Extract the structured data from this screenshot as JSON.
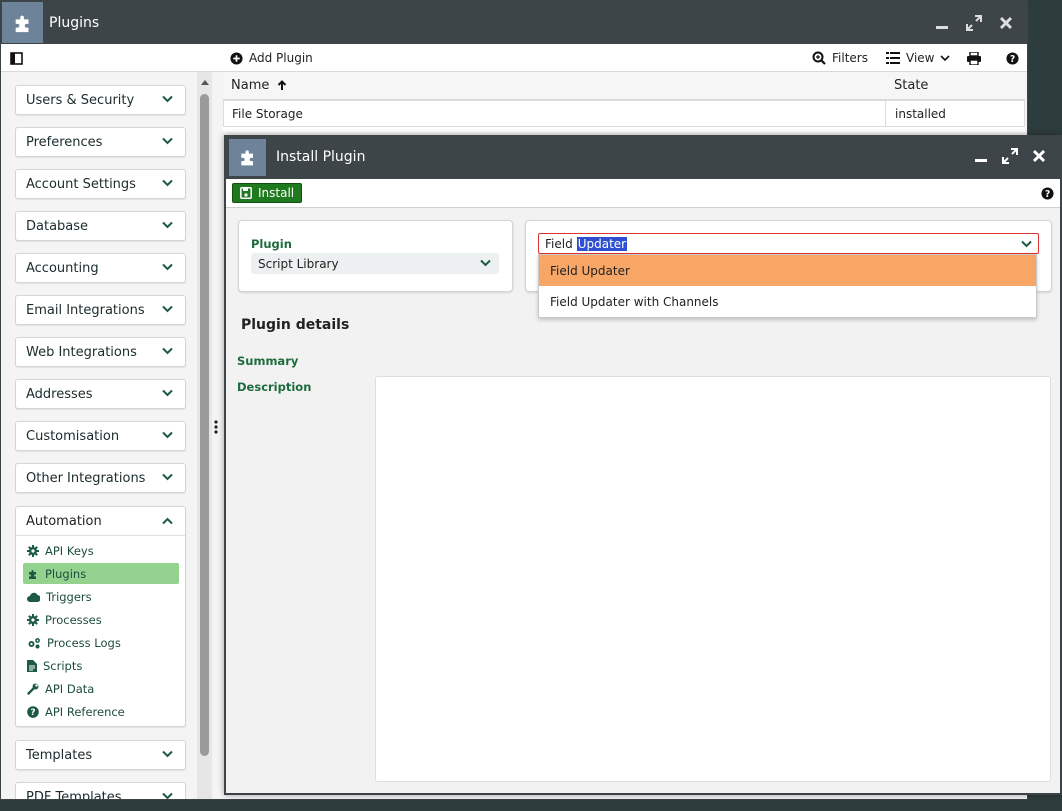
{
  "window": {
    "title": "Plugins",
    "icon": "puzzle-icon"
  },
  "toolbar": {
    "add_plugin": "Add Plugin",
    "filters": "Filters",
    "view": "View"
  },
  "sidebar": {
    "sections": [
      {
        "label": "Users & Security"
      },
      {
        "label": "Preferences"
      },
      {
        "label": "Account Settings"
      },
      {
        "label": "Database"
      },
      {
        "label": "Accounting"
      },
      {
        "label": "Email Integrations"
      },
      {
        "label": "Web Integrations"
      },
      {
        "label": "Addresses"
      },
      {
        "label": "Customisation"
      },
      {
        "label": "Other Integrations"
      }
    ],
    "automation": {
      "label": "Automation",
      "items": [
        {
          "label": "API Keys",
          "icon": "gear-icon"
        },
        {
          "label": "Plugins",
          "icon": "puzzle-icon"
        },
        {
          "label": "Triggers",
          "icon": "cloud-icon"
        },
        {
          "label": "Processes",
          "icon": "gear-icon"
        },
        {
          "label": "Process Logs",
          "icon": "gears-icon"
        },
        {
          "label": "Scripts",
          "icon": "document-icon"
        },
        {
          "label": "API Data",
          "icon": "wrench-icon"
        },
        {
          "label": "API Reference",
          "icon": "question-icon"
        }
      ]
    },
    "after": [
      {
        "label": "Templates"
      },
      {
        "label": "PDF Templates"
      }
    ]
  },
  "grid": {
    "columns": [
      "Name",
      "State"
    ],
    "rows": [
      {
        "name": "File Storage",
        "state": "installed"
      }
    ]
  },
  "dialog": {
    "title": "Install Plugin",
    "install_label": "Install",
    "plugin_label": "Plugin",
    "plugin_value": "Script Library",
    "combo_prefix": "Field",
    "combo_selected": "Updater",
    "options": [
      "Field Updater",
      "Field Updater with Channels"
    ],
    "details_title": "Plugin details",
    "summary_label": "Summary",
    "description_label": "Description"
  },
  "colors": {
    "titlebar": "#3d4548",
    "accent_green": "#1f7a1f",
    "active_item": "#93d38f",
    "option_highlight": "#f7a666"
  }
}
